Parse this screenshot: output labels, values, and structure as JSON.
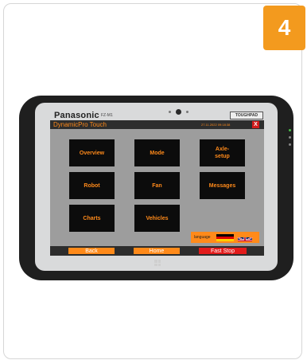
{
  "step_badge": "4",
  "device": {
    "brand": "Panasonic",
    "model": "FZ-M1",
    "product_line": "TOUGHPAD"
  },
  "app": {
    "title": "DynamicPro Touch",
    "datetime": "27.11.2022 09:18:38",
    "close_label": "X"
  },
  "tiles": [
    {
      "label": "Overview"
    },
    {
      "label": "Mode"
    },
    {
      "label": "Axle-\nsetup"
    },
    {
      "label": "Robot"
    },
    {
      "label": "Fan"
    },
    {
      "label": "Messages"
    },
    {
      "label": "Charts"
    },
    {
      "label": "Vehicles"
    }
  ],
  "language": {
    "label": "language"
  },
  "nav": {
    "back": "Back",
    "home": "Home",
    "fast_stop": "Fast Stop"
  },
  "colors": {
    "accent": "#ff8a1a",
    "badge": "#f39a1e",
    "fast_stop": "#e21b1b",
    "tile_bg": "#0c0c0c",
    "screen_bg": "#9d9d9d"
  }
}
